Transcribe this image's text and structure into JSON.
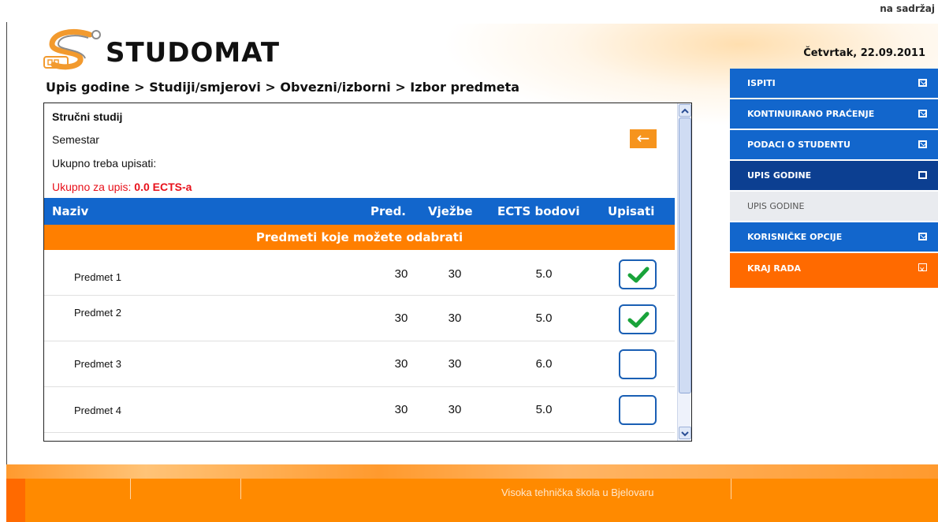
{
  "top": {
    "skip_link": "na sadržaj"
  },
  "header": {
    "logo_text": "STUDOMAT",
    "date": "Četvrtak, 22.09.2011"
  },
  "breadcrumb": "Upis godine > Studiji/smjerovi > Obvezni/izborni > Izbor predmeta",
  "info": {
    "study": "Stručni studij",
    "semester": "Semestar",
    "total_required": "Ukupno treba upisati:",
    "total_enroll_label": "Ukupno za upis:",
    "total_enroll_value": "0.0 ECTS-a"
  },
  "back_icon": "arrow-left-icon",
  "table": {
    "columns": [
      "Naziv",
      "Pred.",
      "Vježbe",
      "ECTS bodovi",
      "Upisati"
    ],
    "group_title": "Predmeti koje možete odabrati",
    "rows": [
      {
        "name": "Predmet 1",
        "pred": "30",
        "vjezbe": "30",
        "ects": "5.0",
        "checked": true
      },
      {
        "name": "Predmet 2",
        "pred": "30",
        "vjezbe": "30",
        "ects": "5.0",
        "checked": true
      },
      {
        "name": "Predmet 3",
        "pred": "30",
        "vjezbe": "30",
        "ects": "6.0",
        "checked": false
      },
      {
        "name": "Predmet 4",
        "pred": "30",
        "vjezbe": "30",
        "ects": "5.0",
        "checked": false
      }
    ]
  },
  "nav": {
    "items": [
      {
        "label": "ISPITI"
      },
      {
        "label": "KONTINUIRANO PRAĆENJE"
      },
      {
        "label": "PODACI O STUDENTU"
      },
      {
        "label": "UPIS GODINE"
      },
      {
        "label": "UPIS GODINE"
      },
      {
        "label": "KORISNIČKE OPCIJE"
      },
      {
        "label": "KRAJ RADA"
      }
    ]
  },
  "footer": {
    "text": "Visoka tehnička škola u Bjelovaru"
  },
  "colors": {
    "blue": "#1266cc",
    "dark_blue": "#0c3f91",
    "orange": "#ff7f00",
    "red_orange": "#ff6a00",
    "check_green": "#19a33a"
  }
}
